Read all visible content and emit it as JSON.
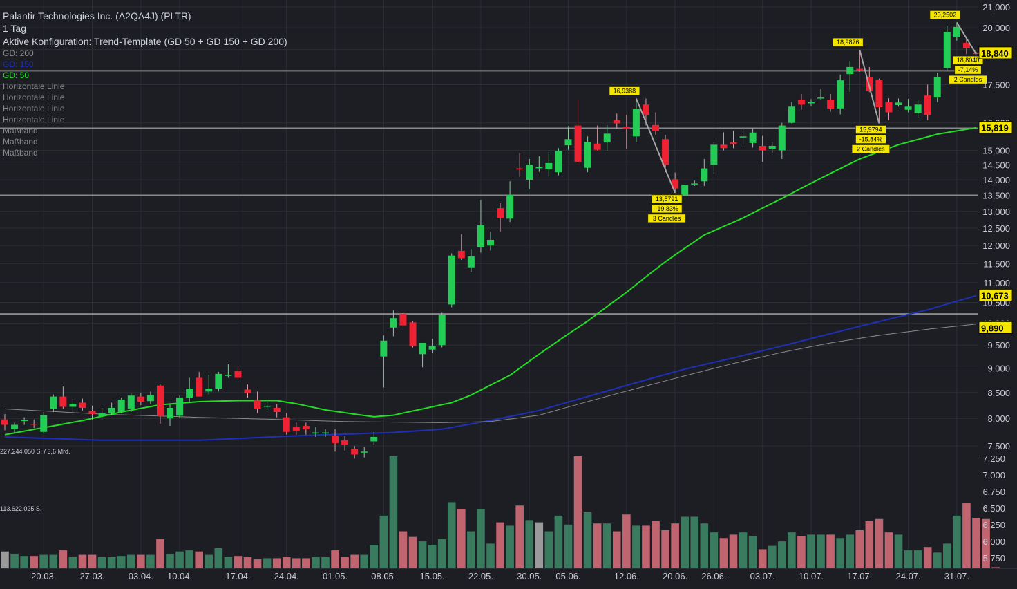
{
  "header": {
    "title": "Palantir Technologies Inc. (A2QA4J) (PLTR)",
    "interval": "1 Tag",
    "config": "Aktive Konfiguration: Trend-Template (GD 50 + GD 150 + GD 200)",
    "legend": [
      {
        "label": "GD: 200",
        "color": "#8a8a8a"
      },
      {
        "label": "GD: 150",
        "color": "#1f2fb8"
      },
      {
        "label": "GD: 50",
        "color": "#22dd22"
      },
      {
        "label": "Horizontale Linie",
        "color": "#8a8a8a"
      },
      {
        "label": "Horizontale Linie",
        "color": "#8a8a8a"
      },
      {
        "label": "Horizontale Linie",
        "color": "#8a8a8a"
      },
      {
        "label": "Horizontale Linie",
        "color": "#8a8a8a"
      },
      {
        "label": "Maßband",
        "color": "#8a8a8a"
      },
      {
        "label": "Maßband",
        "color": "#8a8a8a"
      },
      {
        "label": "Maßband",
        "color": "#8a8a8a"
      }
    ]
  },
  "colors": {
    "background": "#1c1e24",
    "grid": "#2b2e35",
    "up": "#22cc55",
    "down": "#ee2233",
    "up_volume": "#3a7a5e",
    "down_volume": "#c06470",
    "neutral_volume": "#9a9a9a",
    "gd50": "#22dd22",
    "gd150": "#1f2fb8",
    "gd200": "#8a8a8a",
    "hline": "#8a8a8a",
    "tag_bg": "#f5e600"
  },
  "chart_data": {
    "type": "candlestick",
    "price_axis": {
      "scale": "log",
      "range": [
        7000,
        21300
      ],
      "ticks": [
        "7,500",
        "8,000",
        "8,500",
        "9,000",
        "9,500",
        "10,000",
        "10,500",
        "11,000",
        "11,500",
        "12,000",
        "12,500",
        "13,000",
        "13,500",
        "14,000",
        "14,500",
        "15,000",
        "16,000",
        "17,500",
        "19,000",
        "20,000",
        "21,000"
      ]
    },
    "x_axis": {
      "labels": [
        "20.03.",
        "27.03.",
        "03.04.",
        "10.04.",
        "17.04.",
        "24.04.",
        "01.05.",
        "08.05.",
        "15.05.",
        "22.05.",
        "30.05.",
        "05.06.",
        "12.06.",
        "20.06.",
        "26.06.",
        "03.07.",
        "10.07.",
        "17.07.",
        "24.07.",
        "31.07."
      ],
      "label_index": [
        4,
        9,
        14,
        18,
        24,
        29,
        34,
        39,
        44,
        49,
        54,
        58,
        64,
        69,
        73,
        78,
        83,
        88,
        93,
        98
      ]
    },
    "candles": [
      {
        "o": 7.98,
        "h": 8.08,
        "l": 7.78,
        "c": 7.88
      },
      {
        "o": 7.8,
        "h": 7.92,
        "l": 7.72,
        "c": 7.88
      },
      {
        "o": 7.95,
        "h": 8.02,
        "l": 7.88,
        "c": 7.97
      },
      {
        "o": 7.9,
        "h": 7.98,
        "l": 7.82,
        "c": 7.89
      },
      {
        "o": 7.75,
        "h": 8.12,
        "l": 7.72,
        "c": 8.06
      },
      {
        "o": 8.18,
        "h": 8.46,
        "l": 8.12,
        "c": 8.42
      },
      {
        "o": 8.42,
        "h": 8.62,
        "l": 8.18,
        "c": 8.22
      },
      {
        "o": 8.22,
        "h": 8.38,
        "l": 8.1,
        "c": 8.28
      },
      {
        "o": 8.3,
        "h": 8.38,
        "l": 8.15,
        "c": 8.2
      },
      {
        "o": 8.14,
        "h": 8.24,
        "l": 7.98,
        "c": 8.08
      },
      {
        "o": 8.04,
        "h": 8.2,
        "l": 7.98,
        "c": 8.1
      },
      {
        "o": 8.1,
        "h": 8.3,
        "l": 8.06,
        "c": 8.2
      },
      {
        "o": 8.12,
        "h": 8.4,
        "l": 8.1,
        "c": 8.36
      },
      {
        "o": 8.18,
        "h": 8.48,
        "l": 8.12,
        "c": 8.44
      },
      {
        "o": 8.42,
        "h": 8.5,
        "l": 8.25,
        "c": 8.32
      },
      {
        "o": 8.33,
        "h": 8.52,
        "l": 8.28,
        "c": 8.45
      },
      {
        "o": 8.64,
        "h": 8.66,
        "l": 7.9,
        "c": 8.04
      },
      {
        "o": 8.0,
        "h": 8.28,
        "l": 7.86,
        "c": 8.2
      },
      {
        "o": 8.05,
        "h": 8.44,
        "l": 8.0,
        "c": 8.4
      },
      {
        "o": 8.4,
        "h": 8.8,
        "l": 8.3,
        "c": 8.58
      },
      {
        "o": 8.8,
        "h": 8.92,
        "l": 8.42,
        "c": 8.42
      },
      {
        "o": 8.52,
        "h": 8.86,
        "l": 8.46,
        "c": 8.58
      },
      {
        "o": 8.58,
        "h": 8.92,
        "l": 8.52,
        "c": 8.88
      },
      {
        "o": 8.86,
        "h": 9.08,
        "l": 8.8,
        "c": 8.86
      },
      {
        "o": 8.94,
        "h": 9.04,
        "l": 8.76,
        "c": 8.8
      },
      {
        "o": 8.56,
        "h": 8.66,
        "l": 8.4,
        "c": 8.49
      },
      {
        "o": 8.35,
        "h": 8.52,
        "l": 8.1,
        "c": 8.18
      },
      {
        "o": 8.24,
        "h": 8.32,
        "l": 8.16,
        "c": 8.24
      },
      {
        "o": 8.2,
        "h": 8.28,
        "l": 8.02,
        "c": 8.12
      },
      {
        "o": 8.02,
        "h": 8.1,
        "l": 7.7,
        "c": 7.75
      },
      {
        "o": 7.84,
        "h": 7.92,
        "l": 7.7,
        "c": 7.76
      },
      {
        "o": 7.86,
        "h": 7.92,
        "l": 7.7,
        "c": 7.8
      },
      {
        "o": 7.74,
        "h": 7.84,
        "l": 7.66,
        "c": 7.74
      },
      {
        "o": 7.74,
        "h": 7.8,
        "l": 7.66,
        "c": 7.74
      },
      {
        "o": 7.68,
        "h": 7.8,
        "l": 7.4,
        "c": 7.55
      },
      {
        "o": 7.6,
        "h": 7.68,
        "l": 7.42,
        "c": 7.52
      },
      {
        "o": 7.45,
        "h": 7.5,
        "l": 7.28,
        "c": 7.35
      },
      {
        "o": 7.4,
        "h": 7.48,
        "l": 7.3,
        "c": 7.4
      },
      {
        "o": 7.58,
        "h": 7.75,
        "l": 7.52,
        "c": 7.66
      },
      {
        "o": 9.25,
        "h": 9.72,
        "l": 8.6,
        "c": 9.6
      },
      {
        "o": 9.9,
        "h": 10.3,
        "l": 9.7,
        "c": 10.12
      },
      {
        "o": 10.22,
        "h": 10.24,
        "l": 9.9,
        "c": 9.95
      },
      {
        "o": 10.02,
        "h": 10.06,
        "l": 9.45,
        "c": 9.48
      },
      {
        "o": 9.3,
        "h": 9.55,
        "l": 9.02,
        "c": 9.55
      },
      {
        "o": 9.4,
        "h": 9.64,
        "l": 9.32,
        "c": 9.48
      },
      {
        "o": 9.5,
        "h": 10.25,
        "l": 9.45,
        "c": 10.2
      },
      {
        "o": 10.45,
        "h": 11.78,
        "l": 10.38,
        "c": 11.72
      },
      {
        "o": 11.85,
        "h": 12.32,
        "l": 11.6,
        "c": 11.65
      },
      {
        "o": 11.4,
        "h": 11.9,
        "l": 11.28,
        "c": 11.7
      },
      {
        "o": 11.95,
        "h": 13.35,
        "l": 11.8,
        "c": 12.58
      },
      {
        "o": 12.0,
        "h": 12.4,
        "l": 11.86,
        "c": 12.16
      },
      {
        "o": 13.1,
        "h": 13.25,
        "l": 12.4,
        "c": 12.8
      },
      {
        "o": 12.78,
        "h": 13.95,
        "l": 12.68,
        "c": 13.52
      },
      {
        "o": 14.38,
        "h": 14.9,
        "l": 14.1,
        "c": 14.35
      },
      {
        "o": 14.0,
        "h": 14.7,
        "l": 13.7,
        "c": 14.5
      },
      {
        "o": 14.4,
        "h": 14.8,
        "l": 14.26,
        "c": 14.42
      },
      {
        "o": 14.35,
        "h": 14.94,
        "l": 14.1,
        "c": 14.56
      },
      {
        "o": 14.25,
        "h": 15.08,
        "l": 14.15,
        "c": 14.98
      },
      {
        "o": 15.18,
        "h": 15.88,
        "l": 15.02,
        "c": 15.4
      },
      {
        "o": 15.9,
        "h": 16.9,
        "l": 14.48,
        "c": 14.6
      },
      {
        "o": 14.4,
        "h": 15.5,
        "l": 14.25,
        "c": 15.3
      },
      {
        "o": 15.24,
        "h": 15.9,
        "l": 15.0,
        "c": 15.02
      },
      {
        "o": 15.28,
        "h": 15.92,
        "l": 14.98,
        "c": 15.6
      },
      {
        "o": 16.1,
        "h": 16.35,
        "l": 15.8,
        "c": 15.98
      },
      {
        "o": 15.85,
        "h": 16.3,
        "l": 15.05,
        "c": 15.78
      },
      {
        "o": 15.5,
        "h": 16.9,
        "l": 15.3,
        "c": 16.52
      },
      {
        "o": 16.7,
        "h": 16.94,
        "l": 15.9,
        "c": 16.3
      },
      {
        "o": 15.92,
        "h": 16.4,
        "l": 15.55,
        "c": 15.7
      },
      {
        "o": 15.4,
        "h": 15.55,
        "l": 14.25,
        "c": 14.5
      },
      {
        "o": 14.02,
        "h": 14.24,
        "l": 13.58,
        "c": 13.72
      },
      {
        "o": 13.5,
        "h": 13.8,
        "l": 13.48,
        "c": 13.84
      },
      {
        "o": 13.86,
        "h": 13.98,
        "l": 13.8,
        "c": 13.88
      },
      {
        "o": 13.95,
        "h": 14.7,
        "l": 13.8,
        "c": 14.38
      },
      {
        "o": 14.5,
        "h": 15.3,
        "l": 14.2,
        "c": 15.2
      },
      {
        "o": 15.2,
        "h": 15.65,
        "l": 15.0,
        "c": 15.08
      },
      {
        "o": 15.28,
        "h": 15.7,
        "l": 15.08,
        "c": 15.22
      },
      {
        "o": 15.46,
        "h": 15.78,
        "l": 15.2,
        "c": 15.5
      },
      {
        "o": 15.26,
        "h": 15.8,
        "l": 15.1,
        "c": 15.64
      },
      {
        "o": 15.16,
        "h": 15.52,
        "l": 14.6,
        "c": 15.0
      },
      {
        "o": 15.04,
        "h": 15.3,
        "l": 14.92,
        "c": 15.16
      },
      {
        "o": 15.0,
        "h": 16.0,
        "l": 14.7,
        "c": 15.9
      },
      {
        "o": 16.0,
        "h": 16.8,
        "l": 15.98,
        "c": 16.62
      },
      {
        "o": 16.9,
        "h": 17.12,
        "l": 16.5,
        "c": 16.7
      },
      {
        "o": 16.76,
        "h": 16.92,
        "l": 16.64,
        "c": 16.79
      },
      {
        "o": 16.96,
        "h": 17.32,
        "l": 16.9,
        "c": 16.98
      },
      {
        "o": 16.9,
        "h": 17.12,
        "l": 16.42,
        "c": 16.54
      },
      {
        "o": 16.55,
        "h": 17.92,
        "l": 16.32,
        "c": 17.68
      },
      {
        "o": 17.94,
        "h": 18.5,
        "l": 17.2,
        "c": 18.24
      },
      {
        "o": 18.16,
        "h": 18.99,
        "l": 18.04,
        "c": 18.15
      },
      {
        "o": 17.8,
        "h": 18.24,
        "l": 17.2,
        "c": 17.24
      },
      {
        "o": 17.7,
        "h": 17.75,
        "l": 15.98,
        "c": 16.6
      },
      {
        "o": 16.8,
        "h": 16.95,
        "l": 16.1,
        "c": 16.4
      },
      {
        "o": 16.68,
        "h": 16.94,
        "l": 16.62,
        "c": 16.78
      },
      {
        "o": 16.5,
        "h": 16.92,
        "l": 16.4,
        "c": 16.62
      },
      {
        "o": 16.36,
        "h": 16.86,
        "l": 16.2,
        "c": 16.7
      },
      {
        "o": 17.06,
        "h": 17.5,
        "l": 16.1,
        "c": 16.3
      },
      {
        "o": 16.98,
        "h": 18.0,
        "l": 16.8,
        "c": 17.8
      },
      {
        "o": 18.2,
        "h": 20.1,
        "l": 18.1,
        "c": 19.8
      },
      {
        "o": 19.56,
        "h": 20.25,
        "l": 19.4,
        "c": 20.04
      },
      {
        "o": 19.3,
        "h": 19.58,
        "l": 18.8,
        "c": 19.06
      },
      {
        "o": 18.85,
        "h": 18.9,
        "l": 18.8,
        "c": 18.84
      }
    ],
    "moving_averages": [
      {
        "name": "GD: 50",
        "anchors": [
          [
            0,
            7.7
          ],
          [
            5,
            7.86
          ],
          [
            8,
            7.96
          ],
          [
            12,
            8.12
          ],
          [
            16,
            8.26
          ],
          [
            20,
            8.32
          ],
          [
            24,
            8.34
          ],
          [
            28,
            8.34
          ],
          [
            30,
            8.28
          ],
          [
            33,
            8.16
          ],
          [
            36,
            8.08
          ],
          [
            38,
            8.03
          ],
          [
            40,
            8.06
          ],
          [
            43,
            8.18
          ],
          [
            46,
            8.3
          ],
          [
            48,
            8.45
          ],
          [
            52,
            8.85
          ],
          [
            56,
            9.45
          ],
          [
            60,
            10.05
          ],
          [
            64,
            10.75
          ],
          [
            68,
            11.55
          ],
          [
            72,
            12.3
          ],
          [
            76,
            12.8
          ],
          [
            80,
            13.4
          ],
          [
            84,
            14.05
          ],
          [
            88,
            14.7
          ],
          [
            92,
            15.2
          ],
          [
            96,
            15.58
          ],
          [
            100,
            15.82
          ]
        ]
      },
      {
        "name": "GD: 150",
        "anchors": [
          [
            0,
            7.66
          ],
          [
            10,
            7.6
          ],
          [
            20,
            7.6
          ],
          [
            30,
            7.68
          ],
          [
            40,
            7.74
          ],
          [
            45,
            7.8
          ],
          [
            50,
            7.96
          ],
          [
            55,
            8.15
          ],
          [
            60,
            8.42
          ],
          [
            65,
            8.7
          ],
          [
            70,
            8.98
          ],
          [
            75,
            9.22
          ],
          [
            80,
            9.48
          ],
          [
            85,
            9.76
          ],
          [
            90,
            10.04
          ],
          [
            95,
            10.32
          ],
          [
            100,
            10.67
          ]
        ]
      },
      {
        "name": "GD: 200",
        "anchors": [
          [
            0,
            8.18
          ],
          [
            10,
            8.08
          ],
          [
            20,
            8.02
          ],
          [
            30,
            7.97
          ],
          [
            35,
            7.94
          ],
          [
            40,
            7.93
          ],
          [
            45,
            7.92
          ],
          [
            50,
            7.94
          ],
          [
            55,
            8.06
          ],
          [
            60,
            8.32
          ],
          [
            65,
            8.58
          ],
          [
            70,
            8.84
          ],
          [
            75,
            9.1
          ],
          [
            80,
            9.34
          ],
          [
            85,
            9.55
          ],
          [
            90,
            9.72
          ],
          [
            95,
            9.86
          ],
          [
            100,
            9.98
          ]
        ]
      }
    ],
    "horizontal_lines": [
      18.08,
      15.8,
      13.5,
      10.22
    ],
    "price_tags": [
      {
        "value": 18.84,
        "label": "18,840",
        "at": 18.84
      },
      {
        "value": 15.819,
        "label": "15,819",
        "at": 15.819
      },
      {
        "value": 10.673,
        "label": "10,673",
        "at": 10.673
      },
      {
        "value": 9.89,
        "label": "9,890",
        "at": 9.89
      }
    ],
    "measures": [
      {
        "from": [
          65,
          16.9388
        ],
        "to": [
          69,
          13.5791
        ],
        "high_label": "16,9388",
        "low_label": "13,5791",
        "pct": "-19,83%",
        "bars": "3 Candles"
      },
      {
        "from": [
          88,
          18.9876
        ],
        "to": [
          90,
          15.9794
        ],
        "high_label": "18,9876",
        "low_label": "15,9794",
        "pct": "-15,84%",
        "bars": "2 Candles"
      },
      {
        "from": [
          98,
          20.2502
        ],
        "to": [
          100,
          18.804
        ],
        "high_label": "20,2502",
        "low_label": "18,8040",
        "pct": "-7,14%",
        "bars": "2 Candles"
      }
    ],
    "volume": {
      "label_top": "227.244.050 S. / 3,6 Mrd.",
      "label_mid": "113.622.025 S.",
      "max": 227244050,
      "bars": [
        0.15,
        0.13,
        0.11,
        0.11,
        0.12,
        0.12,
        0.16,
        0.1,
        0.12,
        0.12,
        0.1,
        0.1,
        0.11,
        0.12,
        0.12,
        0.12,
        0.26,
        0.13,
        0.15,
        0.16,
        0.15,
        0.12,
        0.18,
        0.1,
        0.11,
        0.1,
        0.08,
        0.09,
        0.09,
        0.1,
        0.09,
        0.09,
        0.1,
        0.1,
        0.16,
        0.1,
        0.12,
        0.12,
        0.21,
        0.47,
        1.0,
        0.33,
        0.28,
        0.24,
        0.21,
        0.26,
        0.59,
        0.53,
        0.33,
        0.53,
        0.22,
        0.41,
        0.38,
        0.56,
        0.43,
        0.41,
        0.33,
        0.47,
        0.39,
        1.0,
        0.5,
        0.4,
        0.4,
        0.33,
        0.48,
        0.38,
        0.38,
        0.42,
        0.34,
        0.4,
        0.46,
        0.46,
        0.4,
        0.32,
        0.27,
        0.3,
        0.32,
        0.29,
        0.17,
        0.2,
        0.24,
        0.32,
        0.29,
        0.3,
        0.3,
        0.3,
        0.27,
        0.3,
        0.34,
        0.42,
        0.44,
        0.32,
        0.3,
        0.16,
        0.16,
        0.19,
        0.14,
        0.22,
        0.47,
        0.58,
        0.45,
        0.44,
        0.01
      ],
      "neutral_index": [
        0,
        55
      ],
      "ticks": [
        "5,750",
        "6,000",
        "6,250",
        "6,500",
        "6,750",
        "7,000",
        "7,250"
      ]
    }
  }
}
